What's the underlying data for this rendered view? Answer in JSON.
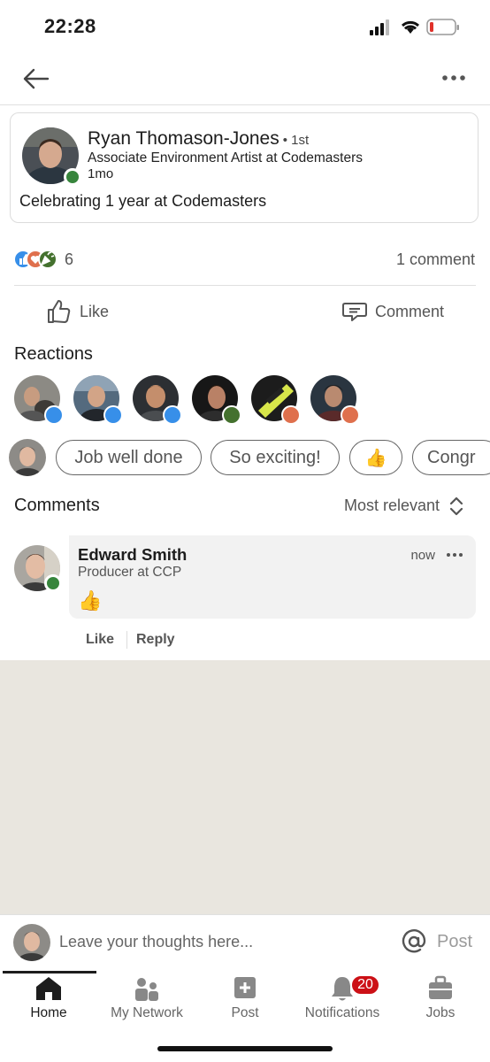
{
  "status_bar": {
    "time": "22:28"
  },
  "post": {
    "author": {
      "name": "Ryan Thomason-Jones",
      "degree": "• 1st",
      "headline": "Associate Environment Artist at Codemasters",
      "time": "1mo"
    },
    "text": "Celebrating 1 year at Codemasters",
    "reaction_count": "6",
    "comment_count": "1 comment"
  },
  "actions": {
    "like": "Like",
    "comment": "Comment"
  },
  "reactions": {
    "heading": "Reactions",
    "people": [
      {
        "type": "like-icon"
      },
      {
        "type": "like-icon"
      },
      {
        "type": "like-icon"
      },
      {
        "type": "celebrate-icon"
      },
      {
        "type": "love-icon"
      },
      {
        "type": "love-icon"
      }
    ]
  },
  "quick_replies": [
    "Job well done",
    "So exciting!",
    "👍",
    "Congr"
  ],
  "comments": {
    "heading": "Comments",
    "sort_label": "Most relevant",
    "items": [
      {
        "name": "Edward Smith",
        "headline": "Producer at CCP",
        "time": "now",
        "body": "👍",
        "like": "Like",
        "reply": "Reply"
      }
    ]
  },
  "composer": {
    "placeholder": "Leave your thoughts here...",
    "post": "Post"
  },
  "tabs": [
    {
      "label": "Home",
      "icon": "home-icon",
      "active": true
    },
    {
      "label": "My Network",
      "icon": "network-icon"
    },
    {
      "label": "Post",
      "icon": "post-icon"
    },
    {
      "label": "Notifications",
      "icon": "bell-icon",
      "badge": "20"
    },
    {
      "label": "Jobs",
      "icon": "briefcase-icon"
    }
  ],
  "colors": {
    "online": "#37853c",
    "like": "#378fe9",
    "love": "#df704d",
    "celebrate": "#44712e",
    "badge": "#cc1016",
    "chip_border": "#666666"
  }
}
